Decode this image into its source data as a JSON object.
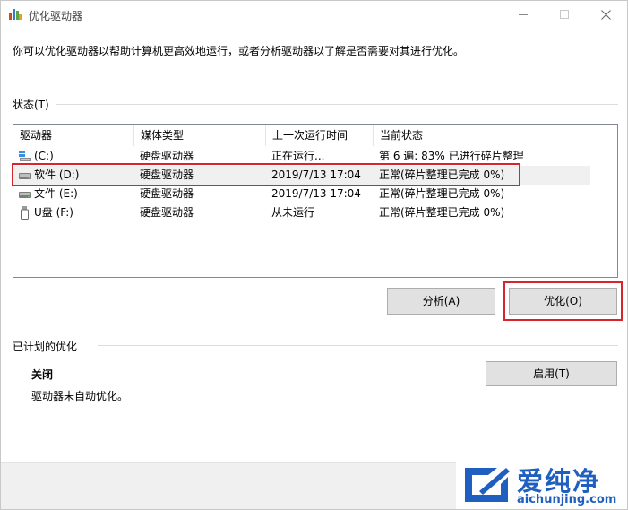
{
  "window": {
    "title": "优化驱动器",
    "description": "你可以优化驱动器以帮助计算机更高效地运行，或者分析驱动器以了解是否需要对其进行优化。"
  },
  "status": {
    "label": "状态(T)",
    "columns": [
      "驱动器",
      "媒体类型",
      "上一次运行时间",
      "当前状态"
    ],
    "rows": [
      {
        "drive": "(C:)",
        "icon": "system-drive-icon",
        "media": "硬盘驱动器",
        "last_run": "正在运行...",
        "state": "第 6 遍: 83% 已进行碎片整理"
      },
      {
        "drive": "软件 (D:)",
        "icon": "hard-drive-icon",
        "media": "硬盘驱动器",
        "last_run": "2019/7/13 17:04",
        "state": "正常(碎片整理已完成 0%)"
      },
      {
        "drive": "文件 (E:)",
        "icon": "hard-drive-icon",
        "media": "硬盘驱动器",
        "last_run": "2019/7/13 17:04",
        "state": "正常(碎片整理已完成 0%)"
      },
      {
        "drive": "U盘 (F:)",
        "icon": "usb-drive-icon",
        "media": "硬盘驱动器",
        "last_run": "从未运行",
        "state": "正常(碎片整理已完成 0%)"
      }
    ],
    "analyze_button": "分析(A)",
    "optimize_button": "优化(O)"
  },
  "scheduled": {
    "label": "已计划的优化",
    "state_title": "关闭",
    "state_text": "驱动器未自动优化。",
    "enable_button": "启用(T)"
  },
  "watermark": {
    "brand": "爱纯净",
    "url": "aichunjing.com"
  },
  "colors": {
    "highlight": "#d9232d",
    "watermark": "#1f5fbf",
    "button_bg": "#e1e1e1",
    "footer_bg": "#f0f0f0"
  }
}
